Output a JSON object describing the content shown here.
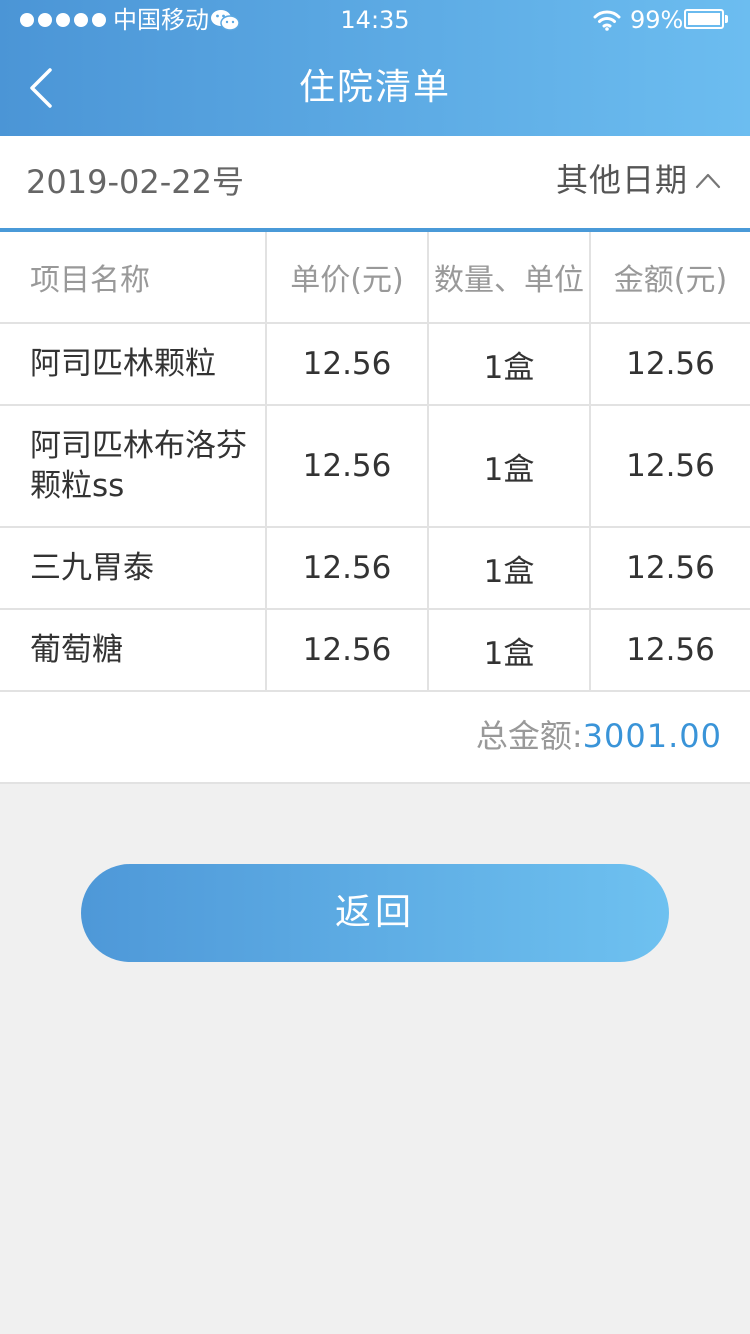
{
  "status_bar": {
    "carrier": "中国移动",
    "time": "14:35",
    "battery": "99%",
    "battery_level": 0.99
  },
  "nav": {
    "title": "住院清单",
    "back_icon": "chevron-left-icon"
  },
  "date_bar": {
    "date": "2019-02-22号",
    "other_dates_label": "其他日期",
    "toggle_icon": "chevron-up-icon"
  },
  "table": {
    "headers": [
      "项目名称",
      "单价(元)",
      "数量、单位",
      "金额(元)"
    ],
    "rows": [
      {
        "name": "阿司匹林颗粒",
        "price": "12.56",
        "qty": "1盒",
        "amount": "12.56"
      },
      {
        "name": "阿司匹林布洛芬颗粒ss",
        "price": "12.56",
        "qty": "1盒",
        "amount": "12.56"
      },
      {
        "name": "三九胃泰",
        "price": "12.56",
        "qty": "1盒",
        "amount": "12.56"
      },
      {
        "name": "葡萄糖",
        "price": "12.56",
        "qty": "1盒",
        "amount": "12.56"
      }
    ]
  },
  "total": {
    "label": "总金额:",
    "value": "3001.00"
  },
  "back_button_label": "返回",
  "colors": {
    "header_start": "#4b95d6",
    "header_end": "#6cbdf0",
    "accent": "#3a94d8",
    "background": "#f0f0f0"
  }
}
